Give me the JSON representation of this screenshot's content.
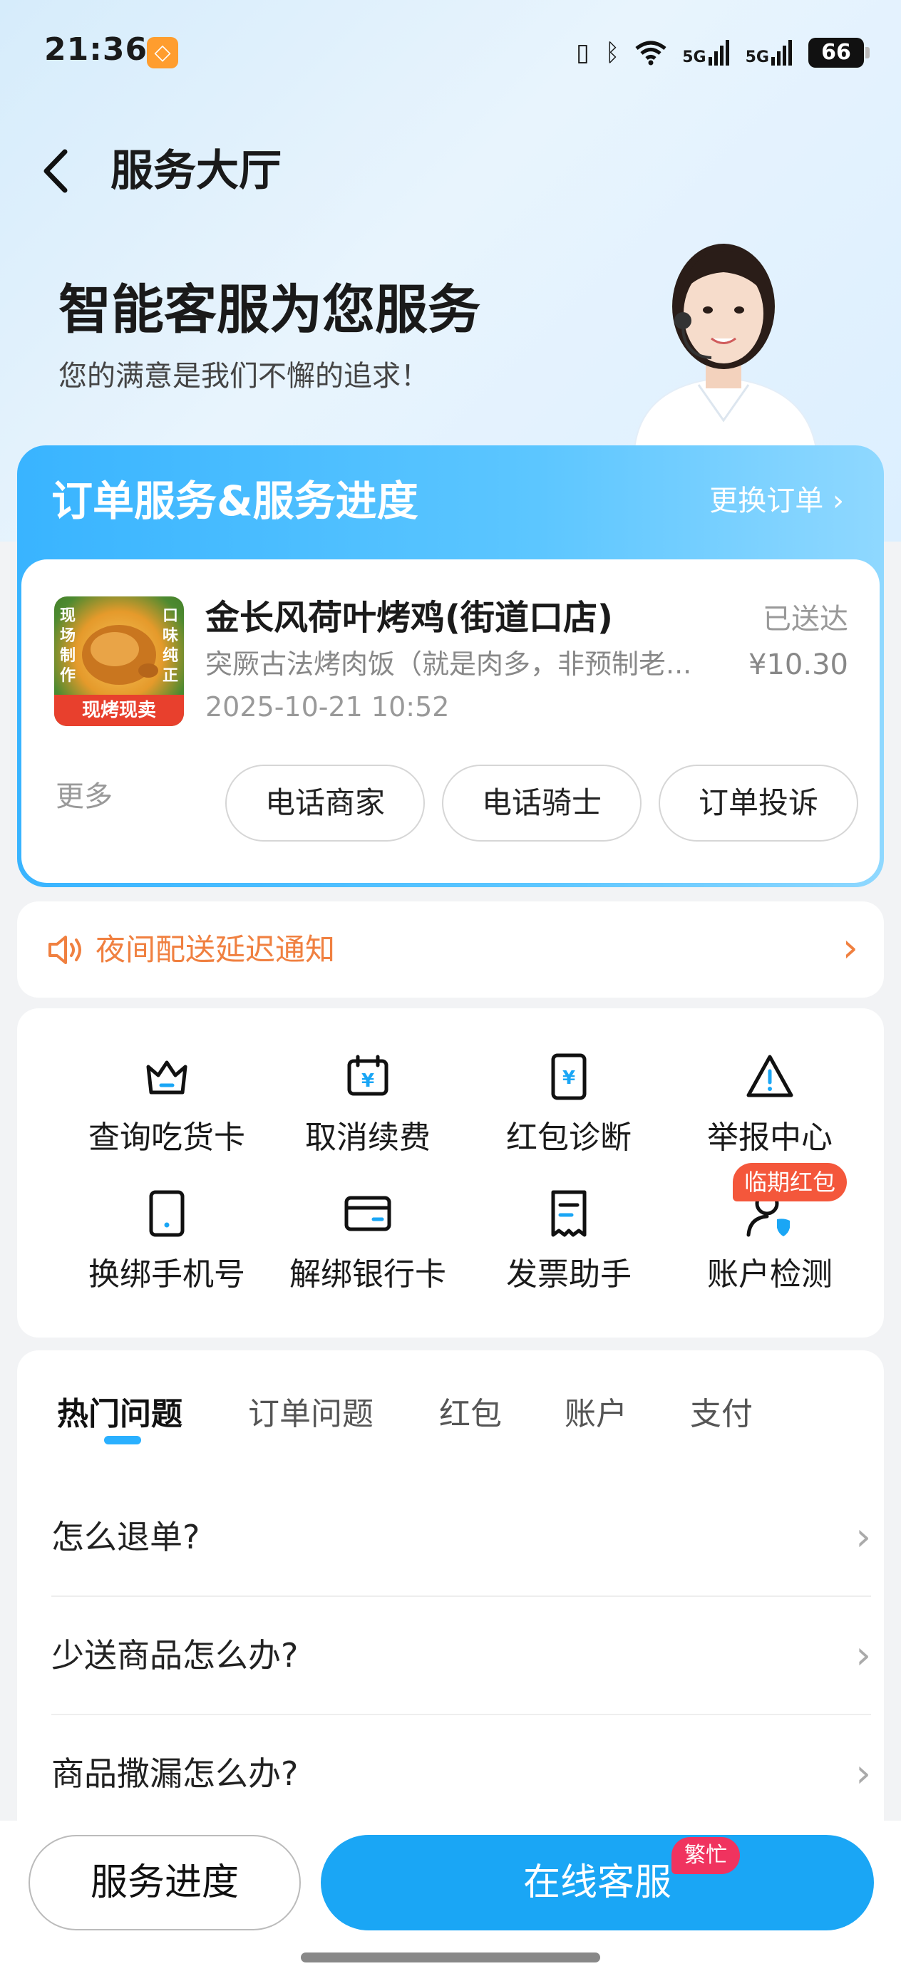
{
  "status_bar": {
    "time": "21:36",
    "net1": "5G",
    "net2": "5G",
    "battery": "66"
  },
  "header": {
    "back_icon": "‹",
    "title": "服务大厅"
  },
  "hero": {
    "title": "智能客服为您服务",
    "subtitle": "您的满意是我们不懈的追求！"
  },
  "order": {
    "section_title": "订单服务&服务进度",
    "change_label": "更换订单 ›",
    "thumb": {
      "left_text": "现场制作",
      "right_text": "口味纯正",
      "banner": "现烤现卖"
    },
    "shop_name": "金长风荷叶烤鸡(街道口店)",
    "description": "突厥古法烤肉饭（就是肉多，非预制老...",
    "time": "2025-10-21 10:52",
    "status": "已送达",
    "price": "¥10.30",
    "more_label": "更多",
    "actions": [
      "电话商家",
      "电话骑士",
      "订单投诉"
    ]
  },
  "notice": {
    "text": "夜间配送延迟通知",
    "arrow": "›"
  },
  "services": {
    "items": [
      {
        "label": "查询吃货卡",
        "icon": "crown-icon"
      },
      {
        "label": "取消续费",
        "icon": "calendar-yuan-icon"
      },
      {
        "label": "红包诊断",
        "icon": "phone-yuan-icon"
      },
      {
        "label": "举报中心",
        "icon": "warning-icon"
      },
      {
        "label": "换绑手机号",
        "icon": "phone-icon"
      },
      {
        "label": "解绑银行卡",
        "icon": "card-icon"
      },
      {
        "label": "发票助手",
        "icon": "receipt-icon"
      },
      {
        "label": "账户检测",
        "icon": "user-shield-icon"
      }
    ],
    "badge": "临期红包"
  },
  "faq": {
    "tabs": [
      "热门问题",
      "订单问题",
      "红包",
      "账户",
      "支付"
    ],
    "questions": [
      "怎么退单?",
      "少送商品怎么办?",
      "商品撒漏怎么办?"
    ]
  },
  "bottom": {
    "progress_label": "服务进度",
    "online_label": "在线客服",
    "busy_badge": "繁忙"
  },
  "colors": {
    "accent": "#1aa6f5",
    "notice": "#f08040",
    "badge_red": "#f4573b"
  }
}
